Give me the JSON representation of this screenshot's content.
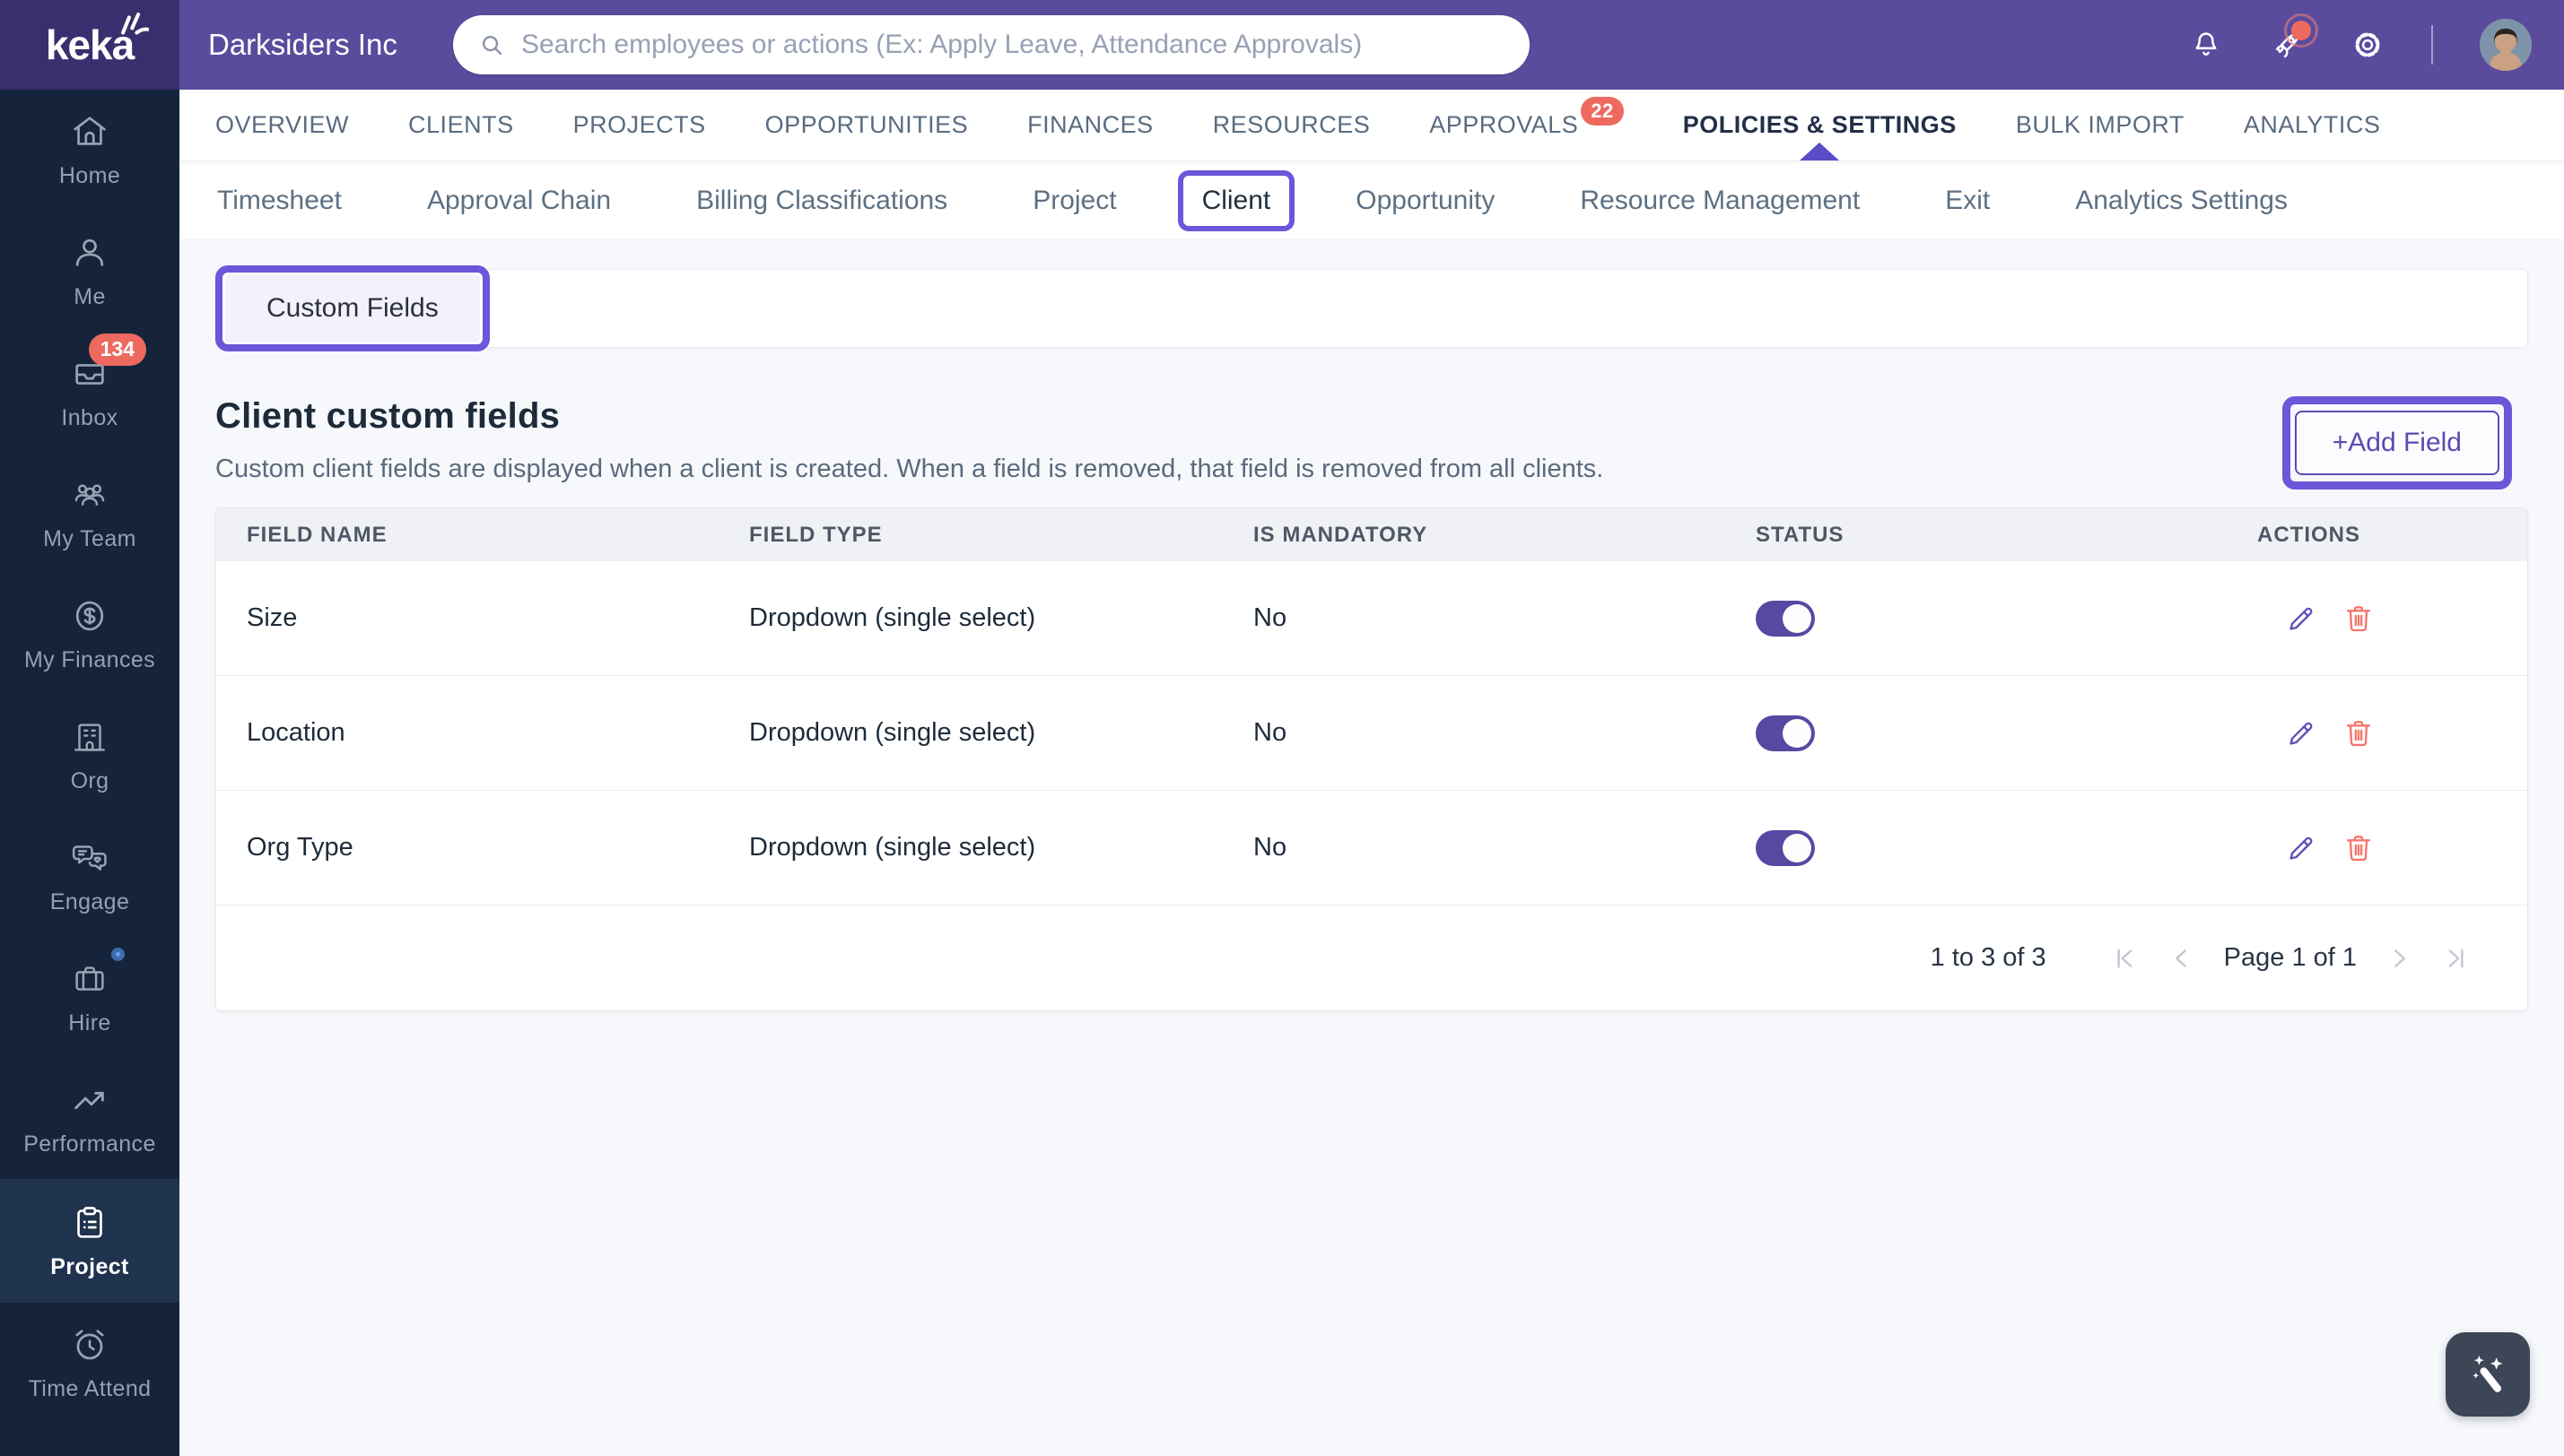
{
  "header": {
    "logo_text": "keka",
    "company_name": "Darksiders Inc",
    "search_placeholder": "Search employees or actions (Ex: Apply Leave, Attendance Approvals)"
  },
  "main_nav": {
    "items": [
      {
        "label": "OVERVIEW"
      },
      {
        "label": "CLIENTS"
      },
      {
        "label": "PROJECTS"
      },
      {
        "label": "OPPORTUNITIES"
      },
      {
        "label": "FINANCES"
      },
      {
        "label": "RESOURCES"
      },
      {
        "label": "APPROVALS",
        "badge": "22"
      },
      {
        "label": "POLICIES & SETTINGS",
        "active": true
      },
      {
        "label": "BULK IMPORT"
      },
      {
        "label": "ANALYTICS"
      }
    ]
  },
  "sub_nav": {
    "items": [
      {
        "label": "Timesheet"
      },
      {
        "label": "Approval Chain"
      },
      {
        "label": "Billing Classifications"
      },
      {
        "label": "Project"
      },
      {
        "label": "Client",
        "active": true,
        "highlighted": true
      },
      {
        "label": "Opportunity"
      },
      {
        "label": "Resource Management"
      },
      {
        "label": "Exit"
      },
      {
        "label": "Analytics Settings"
      }
    ]
  },
  "tabs": {
    "custom_fields_label": "Custom Fields"
  },
  "page": {
    "title": "Client custom fields",
    "description": "Custom client fields are displayed when a client is created. When a field is removed, that field is removed from all clients.",
    "add_field_label": "+Add Field"
  },
  "table": {
    "columns": [
      "FIELD NAME",
      "FIELD TYPE",
      "IS MANDATORY",
      "STATUS",
      "ACTIONS"
    ],
    "rows": [
      {
        "field_name": "Size",
        "field_type": "Dropdown (single select)",
        "is_mandatory": "No",
        "status": "on"
      },
      {
        "field_name": "Location",
        "field_type": "Dropdown (single select)",
        "is_mandatory": "No",
        "status": "on"
      },
      {
        "field_name": "Org Type",
        "field_type": "Dropdown (single select)",
        "is_mandatory": "No",
        "status": "on"
      }
    ]
  },
  "pagination": {
    "range_text": "1 to 3 of 3",
    "page_text": "Page 1 of 1"
  },
  "sidebar": {
    "items": [
      {
        "label": "Home"
      },
      {
        "label": "Me"
      },
      {
        "label": "Inbox",
        "badge": "134"
      },
      {
        "label": "My Team"
      },
      {
        "label": "My Finances"
      },
      {
        "label": "Org"
      },
      {
        "label": "Engage"
      },
      {
        "label": "Hire",
        "dot": true
      },
      {
        "label": "Performance"
      },
      {
        "label": "Project",
        "active": true
      },
      {
        "label": "Time Attend"
      }
    ]
  },
  "icons": {
    "top": [
      "search-icon",
      "bell-icon",
      "rocket-icon",
      "gear-icon"
    ],
    "row_actions": [
      "edit-pencil-icon",
      "delete-trash-icon"
    ],
    "pagination": [
      "first-page-icon",
      "prev-page-icon",
      "next-page-icon",
      "last-page-icon"
    ],
    "fab": "magic-wand-icon"
  },
  "colors": {
    "header_purple": "#5a4b9d",
    "logo_block_purple": "#3a2f6e",
    "sidebar_navy": "#15243a",
    "sidebar_active_navy": "#20334e",
    "accent_purple": "#5b4db4",
    "annotation_purple": "#6c56d9",
    "toggle_on_purple": "#5549a2",
    "badge_red": "#ee6a5f",
    "delete_red": "#f4756c",
    "fab_slate": "#3d4657"
  }
}
